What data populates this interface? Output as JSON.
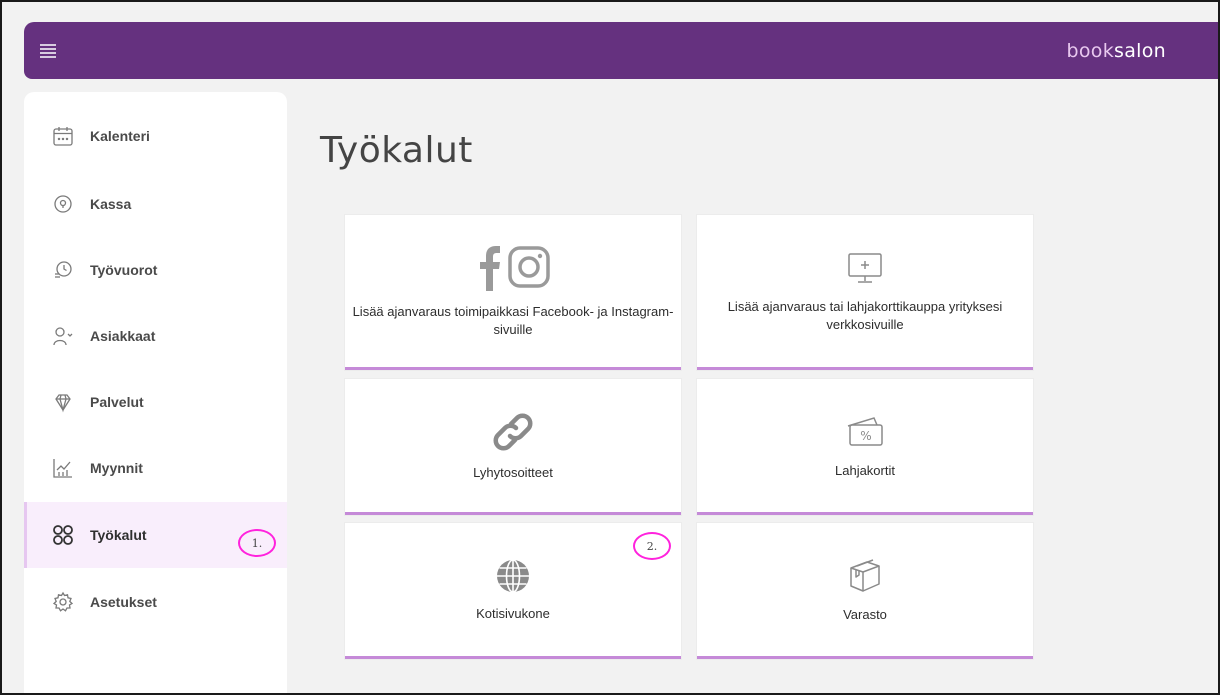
{
  "header": {
    "brand_part1": "book",
    "brand_part2": "salon"
  },
  "sidebar": {
    "items": [
      {
        "label": "Kalenteri",
        "icon": "calendar-icon"
      },
      {
        "label": "Kassa",
        "icon": "location-pin-icon"
      },
      {
        "label": "Työvuorot",
        "icon": "shift-clock-icon"
      },
      {
        "label": "Asiakkaat",
        "icon": "customers-icon"
      },
      {
        "label": "Palvelut",
        "icon": "diamond-icon"
      },
      {
        "label": "Myynnit",
        "icon": "sales-chart-icon"
      },
      {
        "label": "Työkalut",
        "icon": "tools-grid-icon",
        "active": true
      },
      {
        "label": "Asetukset",
        "icon": "settings-gear-icon"
      }
    ]
  },
  "markers": {
    "marker1": "1.",
    "marker2": "2."
  },
  "main": {
    "title": "Työkalut",
    "cards": [
      {
        "label": "Lisää ajanvaraus toimipaikkasi Facebook- ja Instagram-sivuille",
        "icon": "facebook-instagram-icon"
      },
      {
        "label": "Lisää ajanvaraus tai lahjakorttikauppa yrityksesi verkkosivuille",
        "icon": "monitor-icon"
      },
      {
        "label": "Lyhytosoitteet",
        "icon": "link-icon"
      },
      {
        "label": "Lahjakortit",
        "icon": "gift-card-icon"
      },
      {
        "label": "Kotisivukone",
        "icon": "globe-icon"
      },
      {
        "label": "Varasto",
        "icon": "box-icon"
      }
    ]
  },
  "colors": {
    "header_bg": "#65317f",
    "accent_underline": "#c58ad8",
    "active_bg": "#f9eefc",
    "marker": "#ff22dd"
  }
}
